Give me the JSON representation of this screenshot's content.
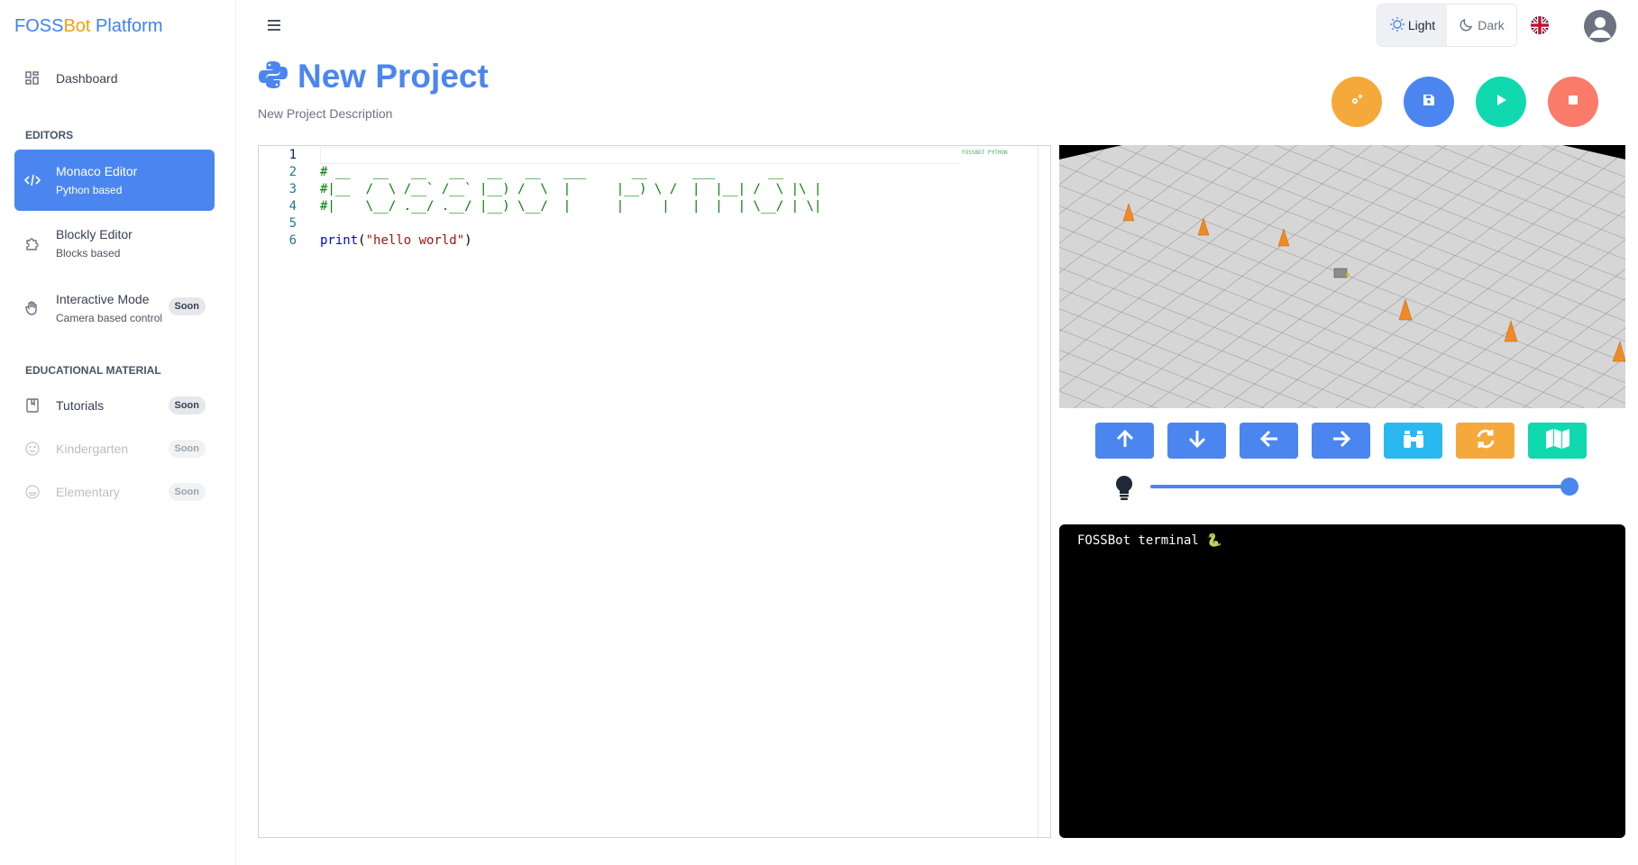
{
  "brand": {
    "foss": "FOSS",
    "bot": "Bot",
    "platform": " Platform"
  },
  "sidebar": {
    "dashboard": {
      "label": "Dashboard",
      "icon": "grid-icon"
    },
    "editors_heading": "EDITORS",
    "editors": [
      {
        "title": "Monaco Editor",
        "subtitle": "Python based",
        "icon": "code-icon",
        "active": true
      },
      {
        "title": "Blockly Editor",
        "subtitle": "Blocks based",
        "icon": "puzzle-icon"
      },
      {
        "title": "Interactive Mode",
        "subtitle": "Camera based control",
        "icon": "hand-icon",
        "badge": "Soon"
      }
    ],
    "edu_heading": "EDUCATIONAL MATERIAL",
    "edu": [
      {
        "title": "Tutorials",
        "icon": "book-icon",
        "badge": "Soon"
      },
      {
        "title": "Kindergarten",
        "icon": "smile-icon",
        "badge": "Soon",
        "disabled": true
      },
      {
        "title": "Elementary",
        "icon": "face-icon",
        "badge": "Soon",
        "disabled": true
      }
    ]
  },
  "topbar": {
    "theme_light": "Light",
    "theme_dark": "Dark",
    "language_icon": "uk-flag-icon",
    "avatar_icon": "user-avatar-icon"
  },
  "page": {
    "title": "New Project",
    "description": "New Project Description",
    "actions": [
      {
        "name": "settings",
        "icon": "gears-icon",
        "color": "#f6a93b"
      },
      {
        "name": "save",
        "icon": "floppy-icon",
        "color": "#4b86f0"
      },
      {
        "name": "run",
        "icon": "play-icon",
        "color": "#10d9b0"
      },
      {
        "name": "stop",
        "icon": "stop-icon",
        "color": "#fa7b6a"
      }
    ]
  },
  "editor": {
    "line_numbers": [
      "1",
      "2",
      "3",
      "4",
      "5",
      "6"
    ],
    "lines": [
      "",
      "# __   __   __   __   __   __   ___      __      ___       __ ",
      "#|__  /  \\ /__` /__` |__) /  \\  |      |__) \\ /  |  |__| /  \\ |\\ |",
      "#|    \\__/ .__/ .__/ |__) \\__/  |      |     |   |  |  | \\__/ | \\|",
      "",
      ""
    ],
    "print_kw": "print",
    "print_open": "(",
    "print_str": "\"hello world\"",
    "print_close": ")",
    "minimap": "FOSSBOT PYTHON"
  },
  "controls": [
    {
      "name": "forward",
      "icon": "arrow-up-icon",
      "color": "#4b86f0"
    },
    {
      "name": "backward",
      "icon": "arrow-down-icon",
      "color": "#4b86f0"
    },
    {
      "name": "left",
      "icon": "arrow-left-icon",
      "color": "#4b86f0"
    },
    {
      "name": "right",
      "icon": "arrow-right-icon",
      "color": "#4b86f0"
    },
    {
      "name": "view",
      "icon": "binoculars-icon",
      "color": "#2ab8f0"
    },
    {
      "name": "reset",
      "icon": "refresh-icon",
      "color": "#f6a93b"
    },
    {
      "name": "map",
      "icon": "map-icon",
      "color": "#10d9b0"
    }
  ],
  "light": {
    "icon": "lightbulb-icon",
    "level": 1.0
  },
  "terminal": {
    "text": "FOSSBot terminal 🐍"
  }
}
